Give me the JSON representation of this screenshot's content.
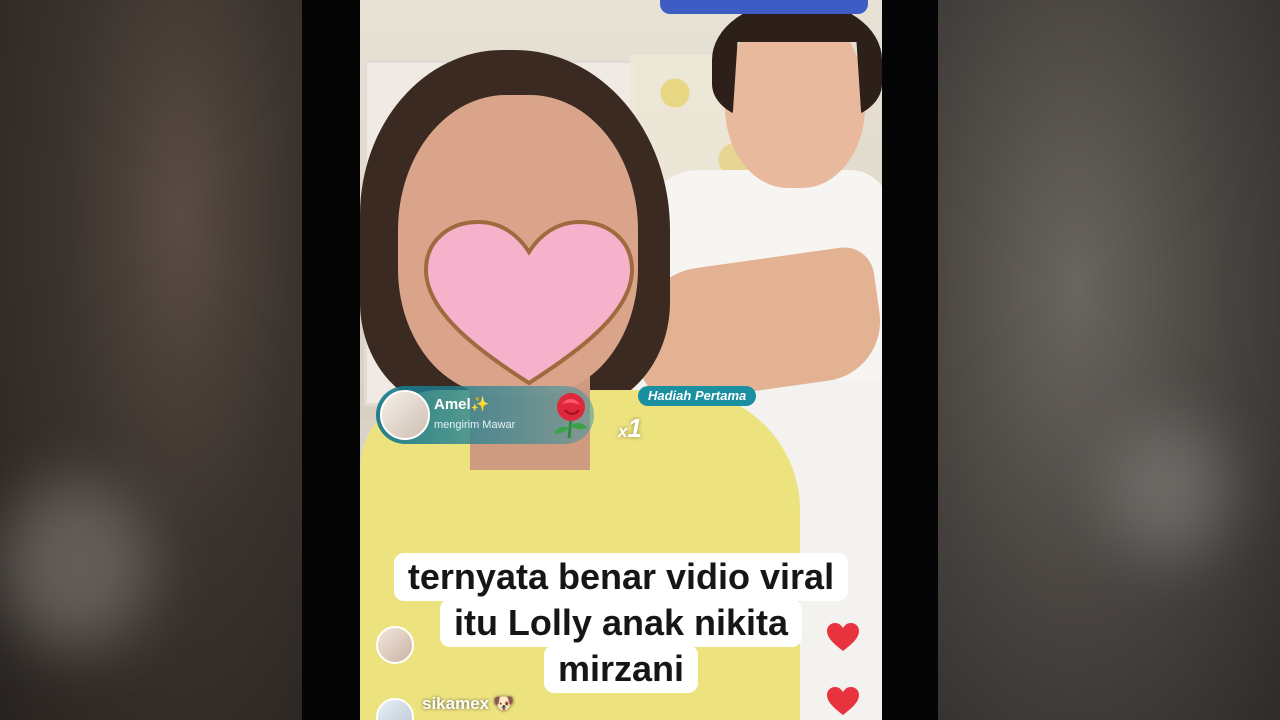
{
  "gift_notification": {
    "username": "Amel✨",
    "action": "mengirim Mawar",
    "count_prefix": "x",
    "count": "1",
    "badge": "Hadiah Pertama",
    "gift_icon": "rose-icon"
  },
  "caption": {
    "lines": [
      "ternyata benar vidio viral",
      "itu Lolly anak nikita",
      "mirzani"
    ]
  },
  "comments": [
    {
      "username": "sikamex",
      "emoji": "🐶"
    }
  ],
  "colors": {
    "caption_bg": "#ffffff",
    "gift_pill": "#1a8fa0",
    "heart_sticker": "#f7b2cb",
    "top_chip": "#3d5dc4"
  }
}
